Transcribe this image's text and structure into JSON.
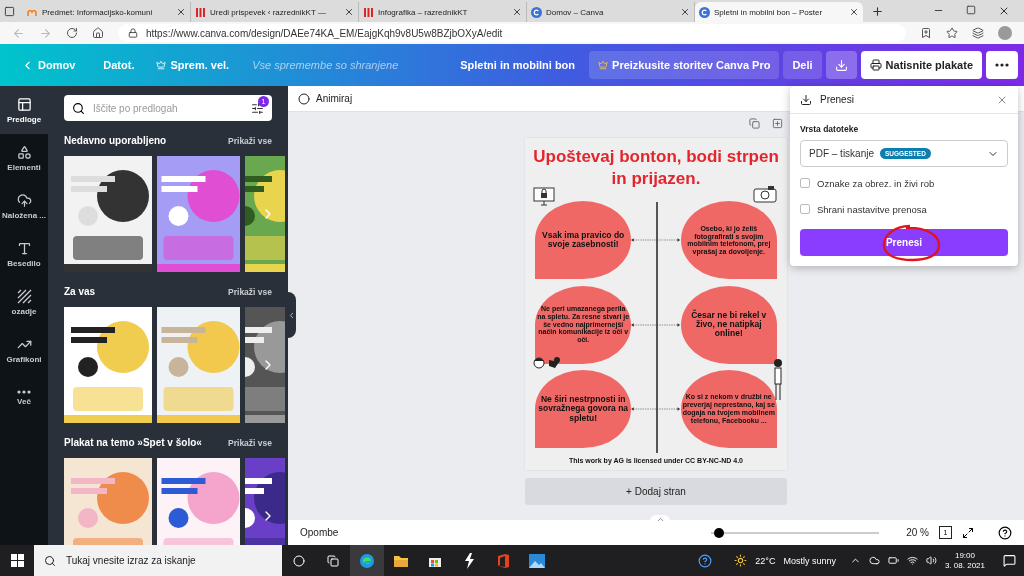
{
  "browser": {
    "tabs": [
      {
        "title": "Predmet: Informacijsko-komuni",
        "selected": false
      },
      {
        "title": "Uredi prispevek ‹ razrednikKT —",
        "selected": false
      },
      {
        "title": "Infografika – razrednikKT",
        "selected": false
      },
      {
        "title": "Domov – Canva",
        "selected": false
      },
      {
        "title": "Spletni in mobilni bon – Poster",
        "selected": true
      }
    ],
    "url": "https://www.canva.com/design/DAEe74KA_EM/EajgKqh9v8U5w8BZjbOXyA/edit"
  },
  "topbar": {
    "home": "Domov",
    "menu": [
      "Datot.",
      "Sprem. vel."
    ],
    "save_status": "Vse spremembe so shranjene",
    "design_title": "Spletni in mobilni bon",
    "pro": "Preizkusite storitev Canva Pro",
    "share": "Deli",
    "print": "Natisnite plakate"
  },
  "rail": [
    {
      "label": "Predloge",
      "selected": true
    },
    {
      "label": "Elementi",
      "selected": false
    },
    {
      "label": "Naložena ...",
      "selected": false
    },
    {
      "label": "Besedilo",
      "selected": false
    },
    {
      "label": "ozadje",
      "selected": false
    },
    {
      "label": "Grafikoni",
      "selected": false
    },
    {
      "label": "Več",
      "selected": false
    }
  ],
  "panel": {
    "search_placeholder": "Iščite po predlogah",
    "filter_badge": "1",
    "sections": [
      {
        "title": "Nedavno uporabljeno",
        "link": "Prikaži vse"
      },
      {
        "title": "Za vas",
        "link": "Prikaži vse"
      },
      {
        "title": "Plakat na temo »Spet v šolo«",
        "link": "Prikaži vse"
      }
    ]
  },
  "editor": {
    "animate": "Animiraj",
    "poster": {
      "title": "Upoštevaj bonton, bodi strpen in prijazen.",
      "rows": [
        {
          "left": {
            "text": "Vsak ima pravico do svoje zasebnosti!",
            "kind": "large"
          },
          "right": {
            "text": "Osebo, ki jo želiš fotografirati s svojim mobilnim telefonom, prej vprašaj za dovoljenje.",
            "kind": "small"
          }
        },
        {
          "left": {
            "text": "Ne peri umazanega perila na spletu. Za resne stvari je še vedno najprimernejši način komunikacije iz oči v oči.",
            "kind": "small"
          },
          "right": {
            "text": "Česar ne bi rekel v živo, ne natipkaj online!",
            "kind": "large"
          }
        },
        {
          "left": {
            "text": "Ne širi nestrpnosti in sovražnega govora na spletu!",
            "kind": "large"
          },
          "right": {
            "text": "Ko si z nekom v družbi ne preverjaj neprestano, kaj se dogaja na tvojem mobilnem telefonu, Facebooku ...",
            "kind": "small"
          }
        }
      ],
      "license": "This work by AG is licensed under CC BY-NC-ND 4.0"
    },
    "add_page": "+ Dodaj stran",
    "notes": "Opombe",
    "zoom": {
      "level": 0.02,
      "reading": "20 %"
    },
    "page_count": "1"
  },
  "download": {
    "title": "Prenesi",
    "file_type_label": "Vrsta datoteke",
    "file_type": "PDF – tiskanje",
    "badge": "SUGGESTED",
    "options": [
      {
        "label": "Oznake za obrez. in živi rob",
        "checked": false
      },
      {
        "label": "Shrani nastavitve prenosa",
        "checked": false
      }
    ],
    "button": "Prenesi"
  },
  "taskbar": {
    "search_placeholder": "Tukaj vnesite izraz za iskanje",
    "temperature": "22°C",
    "weather": "Mostly sunny",
    "time": "19:00",
    "date": "3. 08. 2021"
  }
}
